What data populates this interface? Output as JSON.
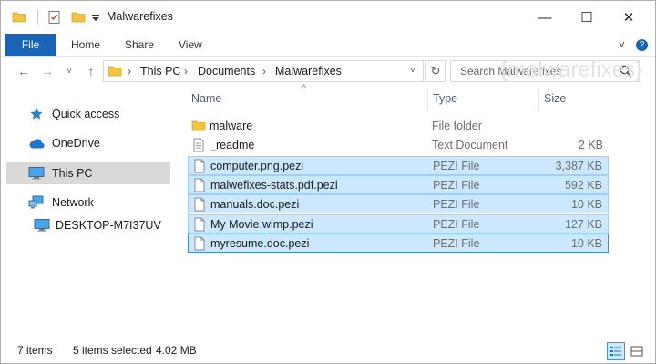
{
  "window": {
    "title": "Malwarefixes",
    "minimize": "—",
    "maximize": "☐",
    "close": "✕"
  },
  "ribbon": {
    "tabs": [
      "File",
      "Home",
      "Share",
      "View"
    ],
    "chevron": "˅",
    "help": "?"
  },
  "address": {
    "breadcrumbs": [
      "This PC",
      "Documents",
      "Malwarefixes"
    ],
    "separator": "›",
    "dropdown": "˅",
    "refresh": "↻"
  },
  "search": {
    "placeholder": "Search Malwarefixes"
  },
  "watermark": "{malwarefixes}",
  "nav": {
    "items": [
      {
        "label": "Quick access",
        "icon": "star-icon"
      },
      {
        "label": "OneDrive",
        "icon": "cloud-icon"
      },
      {
        "label": "This PC",
        "icon": "computer-icon",
        "selected": true
      },
      {
        "label": "Network",
        "icon": "network-icon"
      },
      {
        "label": "DESKTOP-M7I37UV",
        "icon": "desktop-computer-icon"
      }
    ]
  },
  "columns": {
    "name": "Name",
    "type": "Type",
    "size": "Size",
    "sort_indicator": "^"
  },
  "files": [
    {
      "name": "malware",
      "type": "File folder",
      "size": "",
      "icon": "folder-icon",
      "selected": false
    },
    {
      "name": "_readme",
      "type": "Text Document",
      "size": "2 KB",
      "icon": "text-document-icon",
      "selected": false
    },
    {
      "name": "computer.png.pezi",
      "type": "PEZI File",
      "size": "3,387 KB",
      "icon": "file-icon",
      "selected": true
    },
    {
      "name": "malwefixes-stats.pdf.pezi",
      "type": "PEZI File",
      "size": "592 KB",
      "icon": "file-icon",
      "selected": true
    },
    {
      "name": "manuals.doc.pezi",
      "type": "PEZI File",
      "size": "10 KB",
      "icon": "file-icon",
      "selected": true
    },
    {
      "name": "My Movie.wlmp.pezi",
      "type": "PEZI File",
      "size": "127 KB",
      "icon": "file-icon",
      "selected": true
    },
    {
      "name": "myresume.doc.pezi",
      "type": "PEZI File",
      "size": "10 KB",
      "icon": "file-icon",
      "selected": true,
      "focused": true
    }
  ],
  "status": {
    "item_count": "7 items",
    "selection": "5 items selected",
    "selection_size": "4.02 MB"
  },
  "colors": {
    "accent": "#1a64b8",
    "selection_fill": "#cce8ff",
    "selection_border": "#99d1ff",
    "folder": "#f5c343"
  }
}
